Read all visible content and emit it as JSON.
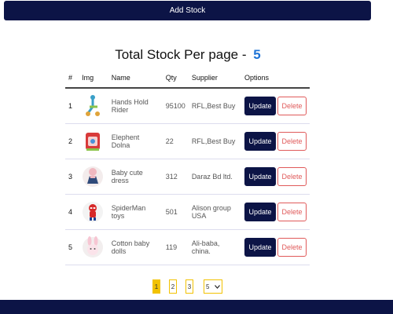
{
  "toolbar": {
    "add_stock_label": "Add Stock"
  },
  "header": {
    "title": "Total Stock Per page -",
    "count": "5"
  },
  "table": {
    "columns": [
      "#",
      "Img",
      "Name",
      "Qty",
      "Supplier",
      "Options"
    ],
    "rows": [
      {
        "num": "1",
        "name": "Hands Hold Rider",
        "qty": "95100",
        "supplier": "RFL,Best Buy",
        "image": "toy-rider-icon"
      },
      {
        "num": "2",
        "name": "Elephent Dolna",
        "qty": "22",
        "supplier": "RFL,Best Buy",
        "image": "elephant-swing-icon"
      },
      {
        "num": "3",
        "name": "Baby cute dress",
        "qty": "312",
        "supplier": "Daraz Bd ltd.",
        "image": "baby-dress-icon"
      },
      {
        "num": "4",
        "name": "SpiderMan toys",
        "qty": "501",
        "supplier": "Alison group USA",
        "image": "spiderman-toy-icon"
      },
      {
        "num": "5",
        "name": "Cotton baby dolls",
        "qty": "119",
        "supplier": "Ali-baba, china.",
        "image": "bunny-doll-icon"
      }
    ],
    "update_label": "Update",
    "delete_label": "Delete"
  },
  "pagination": {
    "pages": [
      "1",
      "2",
      "3"
    ],
    "active": "1",
    "per_page": "5"
  },
  "colors": {
    "navy": "#0c1446",
    "accent": "#f2c200",
    "danger": "#e05a5a",
    "count": "#1e73d6"
  }
}
